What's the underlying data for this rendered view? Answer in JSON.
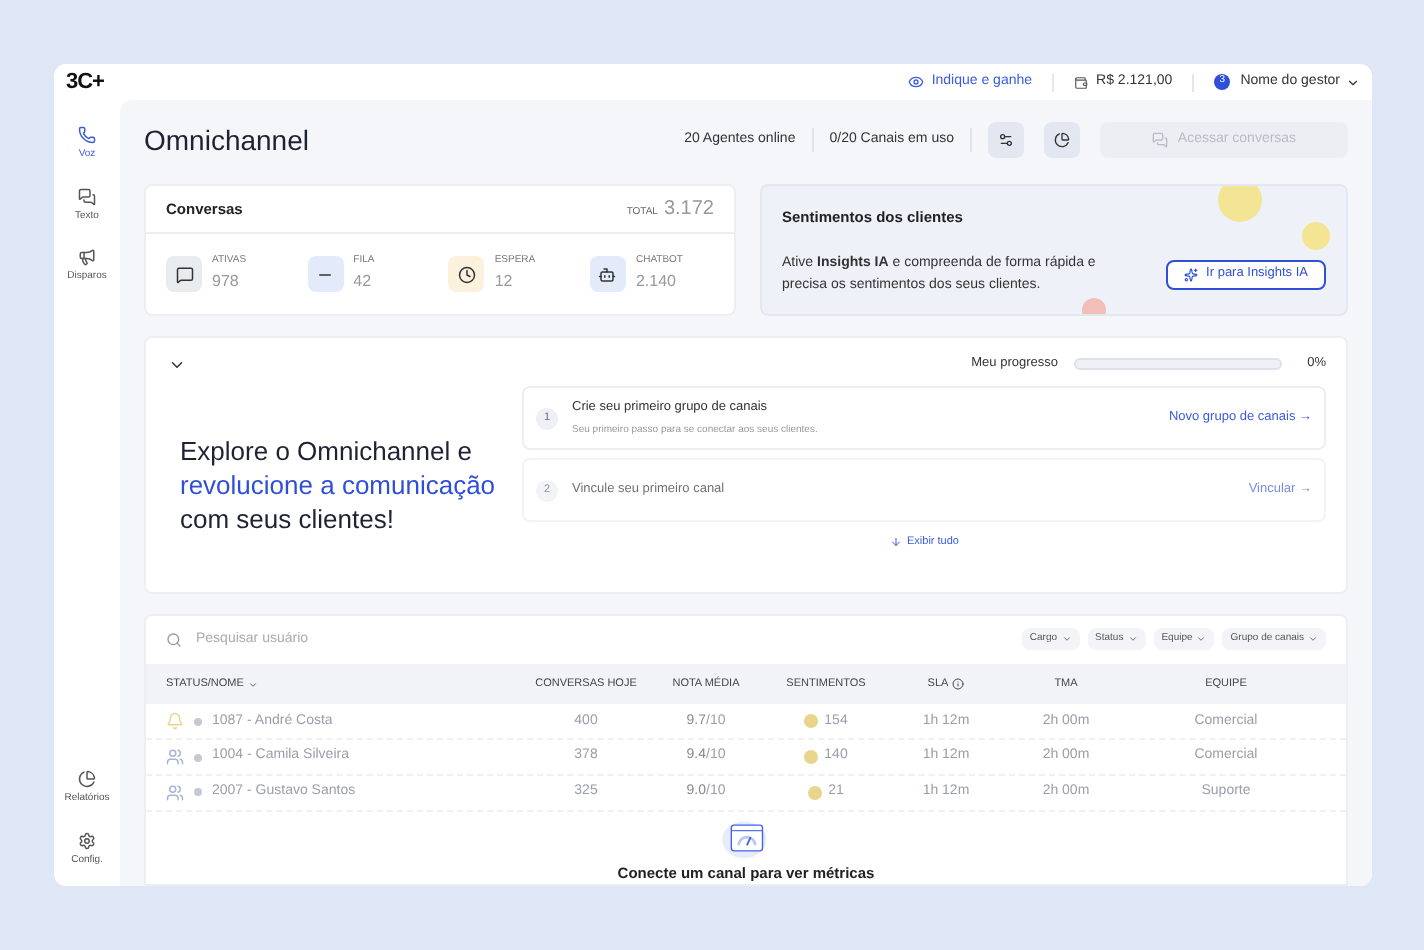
{
  "header": {
    "logo": "3C+",
    "referral_link": "Indique e ganhe",
    "balance": "R$ 2.121,00",
    "user_badge": "3",
    "user_name": "Nome do gestor"
  },
  "sidebar": {
    "items": [
      {
        "kind": "phone",
        "label": "Voz",
        "selected": true
      },
      {
        "kind": "chat",
        "label": "Texto",
        "selected": false
      },
      {
        "kind": "megaphone",
        "label": "Disparos",
        "selected": false
      }
    ],
    "bottom_items": [
      {
        "kind": "chart",
        "label": "Relatórios",
        "selected": false
      },
      {
        "kind": "gear",
        "label": "Config.",
        "selected": false
      }
    ]
  },
  "page": {
    "title": "Omnichannel",
    "agents_online": "20 Agentes online",
    "channels_in_use": "0/20 Canais em uso",
    "access_button": {
      "label": "Acessar conversas",
      "disabled": true
    }
  },
  "conversations": {
    "title": "Conversas",
    "total_label": "TOTAL",
    "total": "3.172",
    "stats": [
      {
        "kind": "active",
        "label": "ATIVAS",
        "value": "978"
      },
      {
        "kind": "queue",
        "label": "FILA",
        "value": "42"
      },
      {
        "kind": "waiting",
        "label": "ESPERA",
        "value": "12"
      },
      {
        "kind": "bot",
        "label": "CHATBOT",
        "value": "2.140"
      }
    ]
  },
  "sentiments": {
    "title": "Sentimentos dos clientes",
    "text": "Ative **Insights IA** e compreenda de forma rápida e precisa os sentimentos dos seus clientes.",
    "button": "Ir para Insights IA"
  },
  "onboarding": {
    "expanded": true,
    "progress_label": "Meu progresso",
    "progress": {
      "level": 0,
      "reading": "0%"
    },
    "headline": [
      {
        "text": "Explore o Omnichannel e ",
        "highlight": false
      },
      {
        "text": "revolucione a comunicação",
        "highlight": true
      },
      {
        "text": " com seus clientes!",
        "highlight": false
      }
    ],
    "steps": [
      {
        "number": "1",
        "title": "Crie seu primeiro grupo de canais",
        "description": "Seu primeiro passo para se conectar aos seus clientes.",
        "action": "Novo grupo de canais →",
        "disabled": false
      },
      {
        "number": "2",
        "title": "Vincule seu primeiro canal",
        "action": "Vincular →",
        "disabled": true
      }
    ],
    "show_all": "Exibir tudo"
  },
  "table": {
    "search_placeholder": "Pesquisar usuário",
    "filters": [
      "Cargo",
      "Status",
      "Equipe",
      "Grupo de canais"
    ],
    "columns": [
      "STATUS/NOME",
      "CONVERSAS HOJE",
      "NOTA MÉDIA",
      "SENTIMENTOS",
      "SLA",
      "TMA",
      "EQUIPE"
    ],
    "rows": [
      {
        "name": "1087 - André Costa",
        "conversations": "400",
        "score": "9.7",
        "score_max": "/10",
        "sentiments": "154",
        "sla": "1h 12m",
        "tma": "2h 00m",
        "team": "Comercial"
      },
      {
        "name": "1004 - Camila Silveira",
        "conversations": "378",
        "score": "9.4",
        "score_max": "/10",
        "sentiments": "140",
        "sla": "1h 12m",
        "tma": "2h 00m",
        "team": "Comercial"
      },
      {
        "name": "2007 - Gustavo Santos",
        "conversations": "325",
        "score": "9.0",
        "score_max": "/10",
        "sentiments": "21",
        "sla": "1h 12m",
        "tma": "2h 00m",
        "team": "Suporte"
      }
    ],
    "empty_state": "Conecte um canal para ver métricas"
  }
}
